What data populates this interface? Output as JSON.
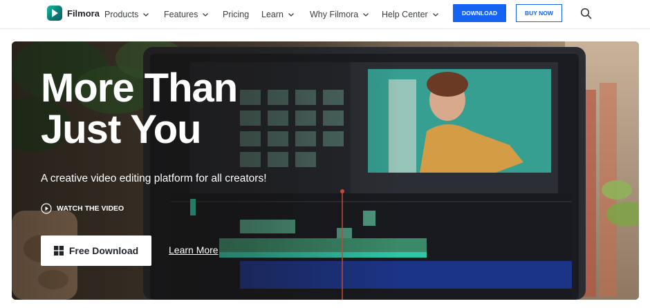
{
  "brand": {
    "name": "Filmora",
    "accent": "#1463f3"
  },
  "nav": {
    "items": [
      {
        "label": "Products",
        "dropdown": true
      },
      {
        "label": "Features",
        "dropdown": true
      },
      {
        "label": "Pricing",
        "dropdown": false
      },
      {
        "label": "Learn",
        "dropdown": true
      },
      {
        "label": "Why Filmora",
        "dropdown": true
      },
      {
        "label": "Help Center",
        "dropdown": true
      }
    ],
    "download_label": "DOWNLOAD",
    "buy_label": "BUY NOW",
    "search_icon": "search-icon"
  },
  "hero": {
    "headline_line1": "More Than",
    "headline_line2": "Just You",
    "subtitle": "A creative video editing platform for all creators!",
    "watch_label": "WATCH THE VIDEO",
    "free_download_label": "Free Download",
    "learn_more_label": "Learn More"
  }
}
